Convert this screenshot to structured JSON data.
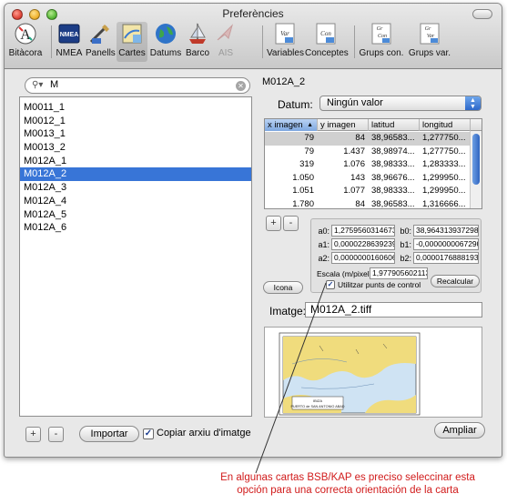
{
  "window": {
    "title": "Preferències"
  },
  "toolbar": {
    "items": [
      {
        "label": "Bitàcora",
        "icon": "bitacora-icon"
      },
      {
        "label": "NMEA",
        "icon": "nmea-icon"
      },
      {
        "label": "Panells",
        "icon": "panells-icon"
      },
      {
        "label": "Cartes",
        "icon": "cartes-icon",
        "selected": true
      },
      {
        "label": "Datums",
        "icon": "datums-globe-icon"
      },
      {
        "label": "Barco",
        "icon": "barco-icon"
      },
      {
        "label": "AIS",
        "icon": "ais-icon",
        "disabled": true
      },
      {
        "label": "Variables",
        "icon": "variables-icon"
      },
      {
        "label": "Conceptes",
        "icon": "conceptes-icon"
      },
      {
        "label": "Grups con.",
        "icon": "grups-con-icon"
      },
      {
        "label": "Grups var.",
        "icon": "grups-var-icon"
      }
    ],
    "icon_text": {
      "nmea": "NMEA",
      "variables": "Var",
      "conceptes": "Con",
      "grups_top": "Gr",
      "grups_con": "Con",
      "grups_var": "Var"
    }
  },
  "search": {
    "value": "M"
  },
  "charts_list": {
    "items": [
      "M0011_1",
      "M0012_1",
      "M0013_1",
      "M0013_2",
      "M012A_1",
      "M012A_2",
      "M012A_3",
      "M012A_4",
      "M012A_5",
      "M012A_6"
    ],
    "selected_index": 5
  },
  "left_footer": {
    "add": "+",
    "remove": "-",
    "import_label": "Importar",
    "copy_checkbox_label": "Copiar arxiu d'imatge",
    "copy_checked": true
  },
  "detail": {
    "chart_name": "M012A_2",
    "datum_label": "Datum:",
    "datum_value": "Ningún valor",
    "table": {
      "columns": [
        "x imagen",
        "y imagen",
        "latitud",
        "longitud"
      ],
      "sorted_column": 0,
      "sort_arrow": "▲",
      "rows": [
        [
          "79",
          "84",
          "38,96583...",
          "1,277750..."
        ],
        [
          "79",
          "1.437",
          "38,98974...",
          "1,277750..."
        ],
        [
          "319",
          "1.076",
          "38,98333...",
          "1,283333..."
        ],
        [
          "1.050",
          "143",
          "38,96676...",
          "1,299950..."
        ],
        [
          "1.051",
          "1.077",
          "38,98333...",
          "1,299950..."
        ],
        [
          "1.780",
          "84",
          "38,96583...",
          "1,316666..."
        ]
      ],
      "selected_row": 0
    },
    "table_add": "+",
    "table_remove": "-",
    "coefficients": {
      "a0_label": "a0:",
      "a0": "1,2759560314673",
      "b0_label": "b0:",
      "b0": "38,964313937298",
      "a1_label": "a1:",
      "a1": "0,0000228639239",
      "b1_label": "b1:",
      "b1": "-0,0000000067290",
      "a2_label": "a2:",
      "a2": "0,0000000160606",
      "b2_label": "b2:",
      "b2": "0,0000176888193",
      "scale_label": "Escala (m/pixel):",
      "scale_value": "1,977905602113",
      "recalc_label": "Recalcular",
      "control_points_label": "Utilitzar punts de control",
      "control_points_checked": true
    },
    "icon_button_label": "Icona",
    "image_label": "Imatge:",
    "image_value": "M012A_2.tiff",
    "map_text": {
      "line1": "IBIZA",
      "line2": "PUERTO de SAN ANTONIO ABAD"
    },
    "zoom_label": "Ampliar"
  },
  "annotation": {
    "text": "En algunas cartas BSB/KAP es preciso seleccinar esta opción para una correcta orientación de la carta",
    "color": "#d11b1b"
  }
}
